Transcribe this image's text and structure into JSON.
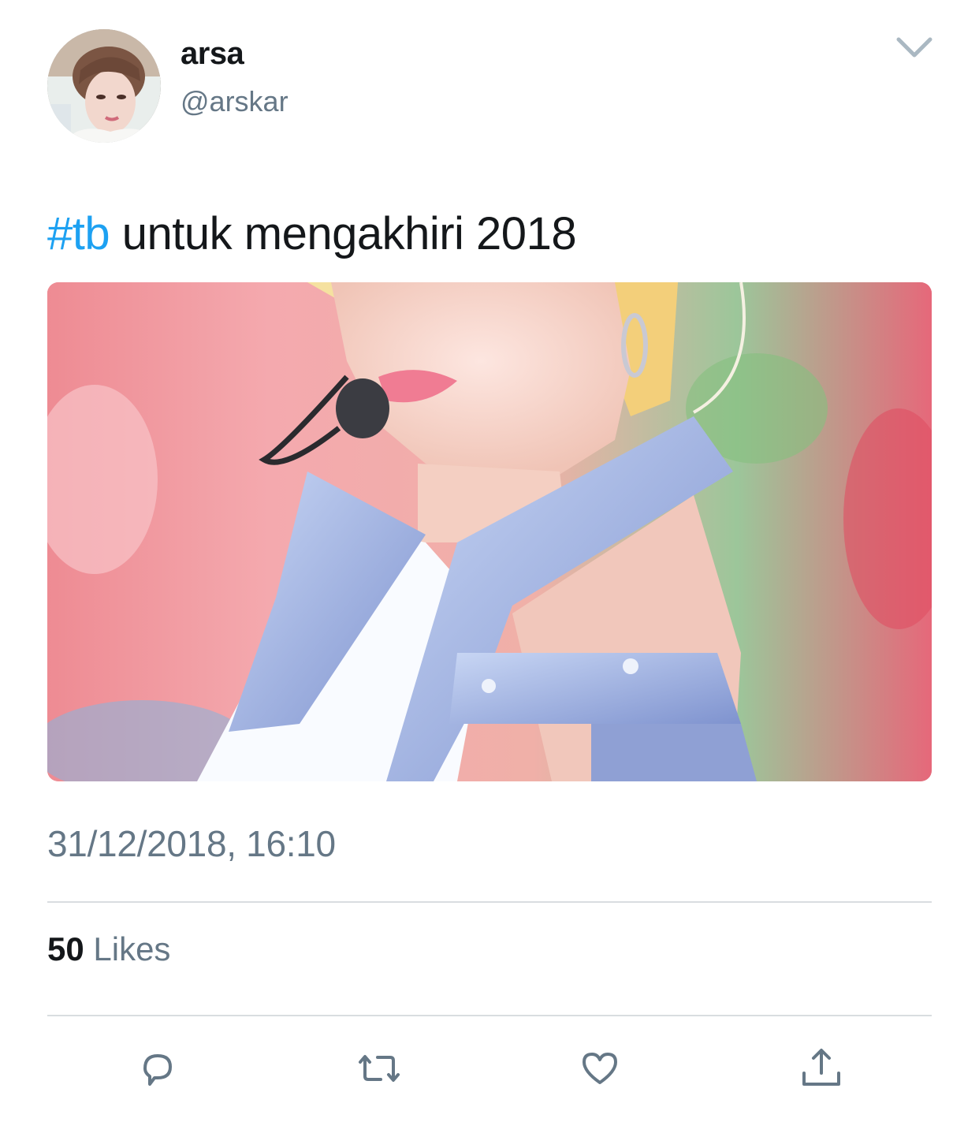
{
  "tweet": {
    "author": {
      "display_name": "arsa",
      "handle": "@arskar",
      "avatar_icon": "profile-photo"
    },
    "text": {
      "hashtag": "#tb",
      "body": " untuk mengakhiri 2018"
    },
    "media_description_icon": "photo",
    "timestamp": "31/12/2018, 16:10",
    "likes": {
      "count": "50",
      "label": " Likes"
    },
    "actions": [
      "reply-icon",
      "retweet-icon",
      "like-icon",
      "share-icon"
    ],
    "colors": {
      "link": "#1da1f2",
      "secondary_text": "#657786",
      "primary_text": "#14171a",
      "icon": "#657786",
      "divider": "#d9dde0"
    }
  }
}
